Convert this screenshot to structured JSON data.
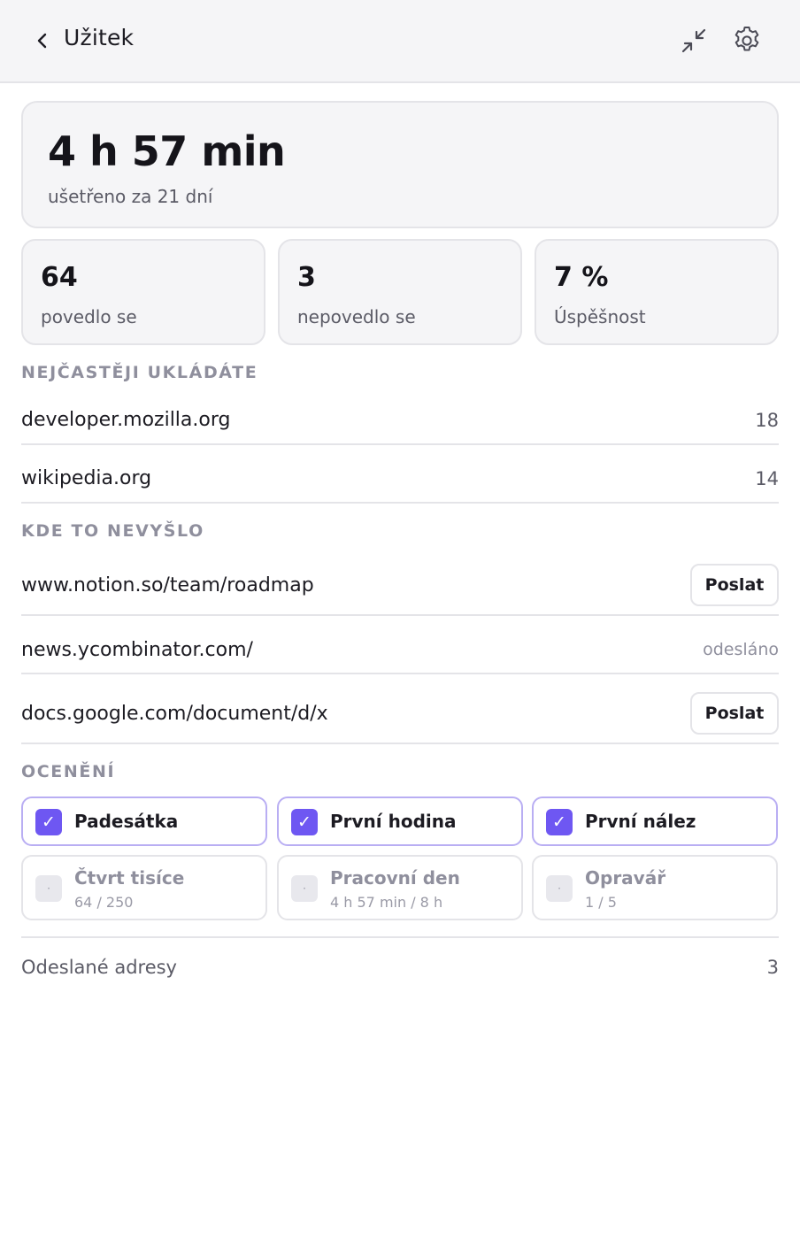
{
  "header": {
    "title": "Užitek",
    "back_icon": "chevron-left-icon",
    "collapse_icon": "collapse-icon",
    "settings_icon": "gear-icon"
  },
  "summary": {
    "saved_time": "4 h 57 min",
    "caption": "ušetřeno za 21 dní"
  },
  "stats": [
    {
      "value": "64",
      "label": "povedlo se"
    },
    {
      "value": "3",
      "label": "nepovedlo se"
    },
    {
      "value": "7 %",
      "label": "Úspěšnost"
    }
  ],
  "top_sites": {
    "title": "NEJČASTĚJI UKLÁDÁTE",
    "items": [
      {
        "domain": "developer.mozilla.org",
        "count": "18"
      },
      {
        "domain": "wikipedia.org",
        "count": "14"
      }
    ]
  },
  "failures": {
    "title": "KDE TO NEVYŠLO",
    "send_label": "Poslat",
    "sent_label": "odesláno",
    "items": [
      {
        "url": "www.notion.so/team/roadmap",
        "state": "send"
      },
      {
        "url": "news.ycombinator.com/",
        "state": "sent"
      },
      {
        "url": "docs.google.com/document/d/x",
        "state": "send"
      }
    ]
  },
  "awards": {
    "title": "OCENĚNÍ",
    "check_glyph": "✓",
    "pending_glyph": "·",
    "earned": [
      {
        "name": "Padesátka"
      },
      {
        "name": "První hodina"
      },
      {
        "name": "První nález"
      }
    ],
    "pending": [
      {
        "name": "Čtvrt tisíce",
        "progress": "64 / 250"
      },
      {
        "name": "Pracovní den",
        "progress": "4 h 57 min / 8 h"
      },
      {
        "name": "Opravář",
        "progress": "1 / 5"
      }
    ]
  },
  "footer": {
    "label": "Odeslané adresy",
    "value": "3"
  },
  "colors": {
    "accent": "#6e57f2",
    "accent_border": "#b9aef3",
    "card_bg": "#f5f5f7",
    "border": "#e4e4e8",
    "muted_text": "#8f8f9d"
  }
}
